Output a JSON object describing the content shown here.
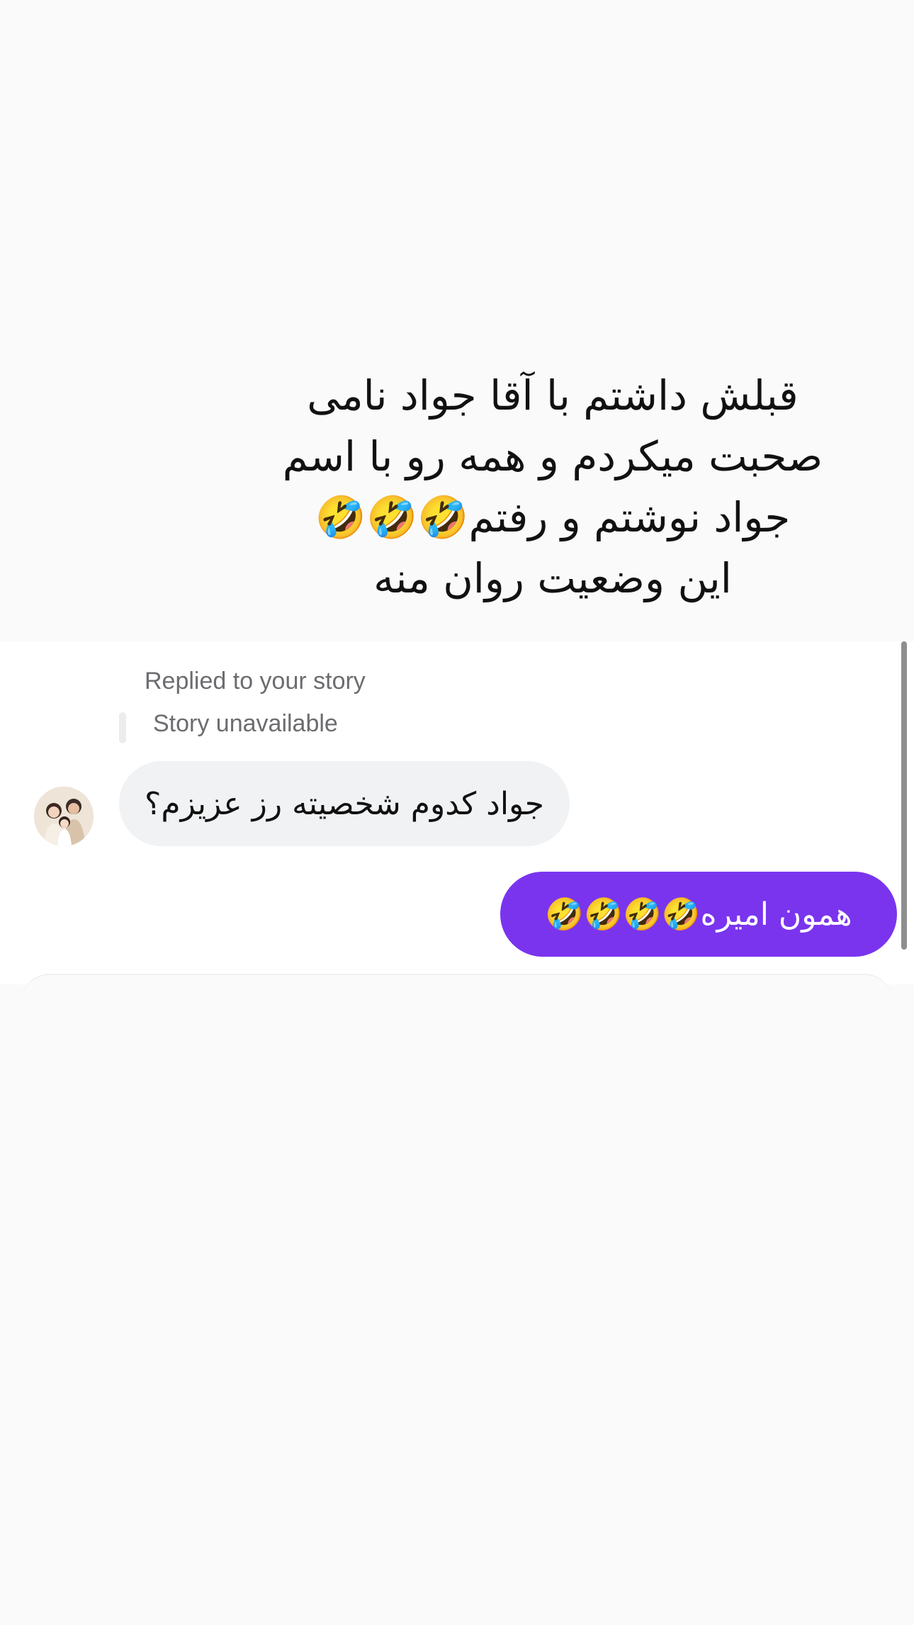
{
  "caption": {
    "text": "قبلش داشتم با آقا جواد نامی\nصحبت میکردم و همه رو با اسم\nجواد نوشتم و رفتم🤣🤣🤣\nاین وضعیت روان منه"
  },
  "thread": {
    "reply_note": "Replied to your story",
    "story_status": "Story unavailable",
    "messages": [
      {
        "direction": "incoming",
        "text": "جواد کدوم شخصیته رز عزیزم؟"
      },
      {
        "direction": "outgoing",
        "text": "همون امیره🤣🤣🤣🤣"
      }
    ]
  },
  "colors": {
    "outgoing_bubble": "#7a34ee",
    "incoming_bubble": "#f1f2f4"
  }
}
